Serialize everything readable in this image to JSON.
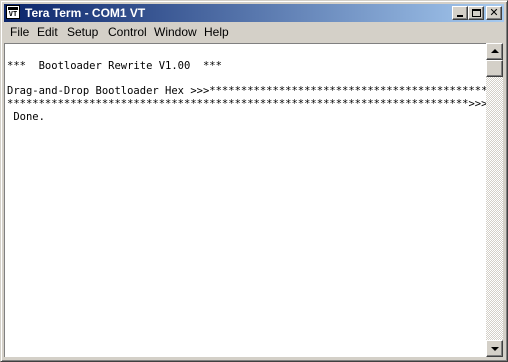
{
  "window": {
    "title": "Tera Term - COM1 VT",
    "icon": "teraterm-vt-icon",
    "icon_text": "VT",
    "controls": {
      "minimize": "minimize-icon",
      "maximize": "maximize-icon",
      "close": "close-icon"
    }
  },
  "menu": {
    "items": [
      {
        "label": "File"
      },
      {
        "label": "Edit"
      },
      {
        "label": "Setup"
      },
      {
        "label": "Control"
      },
      {
        "label": "Window"
      },
      {
        "label": "Help"
      }
    ]
  },
  "terminal": {
    "lines": [
      "",
      "***  Bootloader Rewrite V1.00  ***",
      "",
      "Drag-and-Drop Bootloader Hex >>>**********************************************",
      "*************************************************************************>>>",
      " Done."
    ]
  },
  "scrollbar": {
    "up": "scroll-up-arrow-icon",
    "down": "scroll-down-arrow-icon"
  }
}
